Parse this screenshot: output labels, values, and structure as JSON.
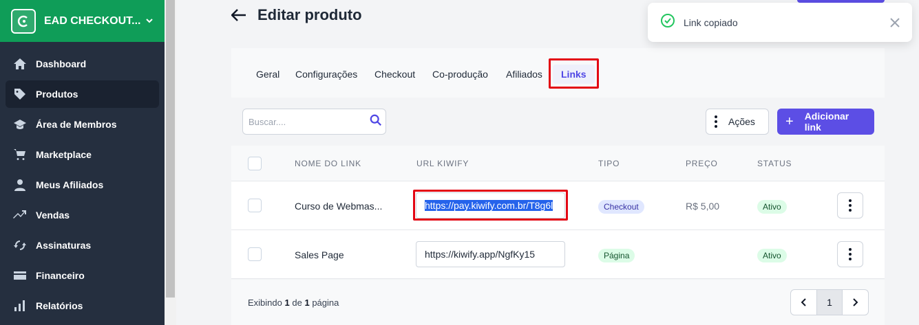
{
  "sidebar": {
    "brand": "EAD CHECKOUT...",
    "items": [
      {
        "label": "Dashboard",
        "icon": "home-icon"
      },
      {
        "label": "Produtos",
        "icon": "tag-icon"
      },
      {
        "label": "Área de Membros",
        "icon": "graduation-cap-icon"
      },
      {
        "label": "Marketplace",
        "icon": "cart-icon"
      },
      {
        "label": "Meus Afiliados",
        "icon": "user-icon"
      },
      {
        "label": "Vendas",
        "icon": "trending-up-icon"
      },
      {
        "label": "Assinaturas",
        "icon": "refresh-icon"
      },
      {
        "label": "Financeiro",
        "icon": "credit-card-icon"
      },
      {
        "label": "Relatórios",
        "icon": "bar-chart-icon"
      }
    ]
  },
  "header": {
    "title": "Editar produto"
  },
  "tabs": [
    "Geral",
    "Configurações",
    "Checkout",
    "Co-produção",
    "Afiliados",
    "Links"
  ],
  "toolbar": {
    "search_placeholder": "Buscar....",
    "actions_label": "Ações",
    "add_label": "Adicionar link"
  },
  "table": {
    "headers": [
      "NOME DO LINK",
      "URL KIWIFY",
      "TIPO",
      "PREÇO",
      "STATUS"
    ],
    "rows": [
      {
        "name": "Curso de Webmas...",
        "url": "https://pay.kiwify.com.br/T8g6l",
        "type": "Checkout",
        "price": "R$ 5,00",
        "status": "Ativo"
      },
      {
        "name": "Sales Page",
        "url": "https://kiwify.app/NgfKy15",
        "type": "Página",
        "price": "",
        "status": "Ativo"
      }
    ]
  },
  "footer": {
    "prefix": "Exibindo",
    "current": "1",
    "of": "de",
    "total": "1",
    "suffix": "página",
    "page": "1"
  },
  "toast": {
    "message": "Link copiado"
  },
  "colors": {
    "brand": "#0f9d58",
    "accent": "#5c4ee5",
    "sidebar": "#252f3f",
    "highlight": "#e30613"
  }
}
